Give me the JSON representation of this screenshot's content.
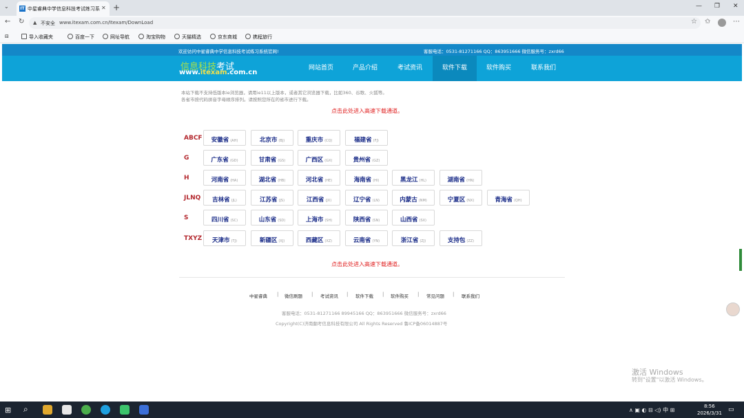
{
  "browser": {
    "tab_title": "中星睿典中学信息科技考试练习系",
    "tab_close": "✕",
    "new_tab": "+",
    "insecure_label": "不安全",
    "url": "www.itexam.com.cn/Itexam/DownLoad",
    "window_controls": [
      "—",
      "❐",
      "✕"
    ],
    "favorites": [
      {
        "label": "导入收藏夹",
        "icon": "import-icon"
      },
      {
        "label": "百度一下",
        "icon": "globe-icon"
      },
      {
        "label": "网址导航",
        "icon": "globe-icon"
      },
      {
        "label": "淘宝购物",
        "icon": "globe-icon"
      },
      {
        "label": "天猫精选",
        "icon": "globe-icon"
      },
      {
        "label": "京东商城",
        "icon": "globe-icon"
      },
      {
        "label": "携程旅行",
        "icon": "globe-icon"
      }
    ]
  },
  "header": {
    "welcome": "欢迎访问中星睿典中学信息科技考试练习系统官网!",
    "contact": "客服电话：0531-81271166  QQ：863951666   微信服务号：zxrd66",
    "logo_line1_a": "信息科技",
    "logo_line1_b": "考试",
    "logo_line2_a": "www.",
    "logo_line2_b": "itexam",
    "logo_line2_c": ".com.cn",
    "nav": [
      "网站首页",
      "产品介绍",
      "考试资讯",
      "软件下载",
      "软件购买",
      "联系我们"
    ],
    "nav_active_index": 3
  },
  "notice": {
    "line1": "本站下载不支持低版本ie浏览器，请用ie11以上版本，或者其它浏览器下载，比如360、谷歌、火狐等。",
    "line2": "各省市按代码拼音字母顺序排列。请按照您所在的省市进行下载。",
    "fast_link": "点击此处进入高速下载通道。"
  },
  "groups": [
    {
      "label": "ABCF",
      "items": [
        [
          "安徽省",
          "(AH)"
        ],
        [
          "北京市",
          "(BJ)"
        ],
        [
          "重庆市",
          "(CQ)"
        ],
        [
          "福建省",
          "(FJ)"
        ]
      ]
    },
    {
      "label": "G",
      "items": [
        [
          "广东省",
          "(GD)"
        ],
        [
          "甘肃省",
          "(GS)"
        ],
        [
          "广西区",
          "(GX)"
        ],
        [
          "贵州省",
          "(GZ)"
        ]
      ]
    },
    {
      "label": "H",
      "items": [
        [
          "河南省",
          "(HA)"
        ],
        [
          "湖北省",
          "(HB)"
        ],
        [
          "河北省",
          "(HE)"
        ],
        [
          "海南省",
          "(HI)"
        ],
        [
          "黑龙江",
          "(HL)"
        ],
        [
          "湖南省",
          "(HN)"
        ]
      ]
    },
    {
      "label": "JLNQ",
      "items": [
        [
          "吉林省",
          "(JL)"
        ],
        [
          "江苏省",
          "(JS)"
        ],
        [
          "江西省",
          "(JX)"
        ],
        [
          "辽宁省",
          "(LN)"
        ],
        [
          "内蒙古",
          "(NM)"
        ],
        [
          "宁夏区",
          "(NX)"
        ],
        [
          "青海省",
          "(QH)"
        ]
      ]
    },
    {
      "label": "S",
      "items": [
        [
          "四川省",
          "(SC)"
        ],
        [
          "山东省",
          "(SD)"
        ],
        [
          "上海市",
          "(SH)"
        ],
        [
          "陕西省",
          "(SN)"
        ],
        [
          "山西省",
          "(SX)"
        ]
      ]
    },
    {
      "label": "TXYZ",
      "items": [
        [
          "天津市",
          "(TJ)"
        ],
        [
          "新疆区",
          "(XJ)"
        ],
        [
          "西藏区",
          "(XZ)"
        ],
        [
          "云南省",
          "(YN)"
        ],
        [
          "浙江省",
          "(ZJ)"
        ],
        [
          "支持包",
          "(ZZ)"
        ]
      ]
    }
  ],
  "footer": {
    "links": [
      "中星睿典",
      "微信刷题",
      "考试资讯",
      "软件下载",
      "软件购买",
      "常见问题",
      "联系我们"
    ],
    "separator": "|",
    "contact": "客服电话：0531-81271166  89945166   QQ：863951666      微信服务号：zxrd66",
    "copyright": "Copyright(C)济南翻考信息科技有限公司 All Rights Reserved      鲁ICP备06014887号"
  },
  "activation": {
    "title": "激活 Windows",
    "subtitle": "转到\"设置\"以激活 Windows。"
  },
  "taskbar": {
    "tray": "∧  ▣  ◐  ⊟  ◁)  中  ⊞",
    "time": "8:56",
    "date": "2026/3/31"
  },
  "colors": {
    "top_strip": "#1488c8",
    "nav_bar": "#0ea3d8",
    "nav_active": "#0b89bd",
    "province_text": "#1a2c88",
    "group_label": "#b3272d",
    "red_link": "#e02020"
  }
}
